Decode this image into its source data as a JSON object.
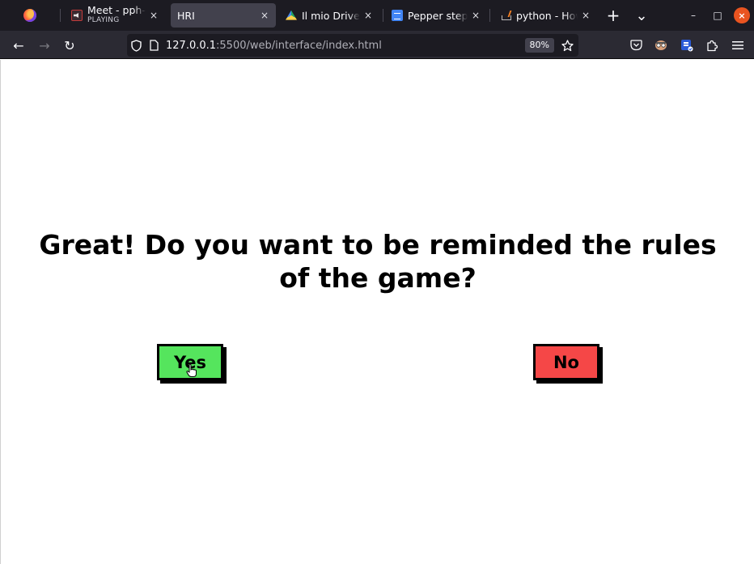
{
  "browser": {
    "tabs": [
      {
        "title": "Meet - pph-iet",
        "subtitle": "PLAYING",
        "favicon": "google-meet-icon",
        "active": false
      },
      {
        "title": "HRI",
        "subtitle": "",
        "favicon": "",
        "active": true
      },
      {
        "title": "Il mio Drive - Go",
        "subtitle": "",
        "favicon": "google-drive-icon",
        "active": false
      },
      {
        "title": "Pepper steps",
        "subtitle": "",
        "favicon": "google-docs-icon",
        "active": false
      },
      {
        "title": "python - How to",
        "subtitle": "",
        "favicon": "stackoverflow-icon",
        "active": false
      }
    ],
    "close_glyph": "×",
    "new_tab_glyph": "+",
    "list_tabs_glyph": "⌄",
    "window": {
      "minimize": "–",
      "maximize": "□",
      "close": "×"
    },
    "nav": {
      "back": "←",
      "forward": "→",
      "reload": "↻"
    },
    "url": {
      "host": "127.0.0.1",
      "rest": ":5500/web/interface/index.html"
    },
    "zoom": "80%",
    "accent": "#e95420"
  },
  "page": {
    "question": "Great! Do you want to be reminded the rules of the game?",
    "yes_label": "Yes",
    "no_label": "No",
    "yes_color": "#55e55d",
    "no_color": "#f54747"
  }
}
